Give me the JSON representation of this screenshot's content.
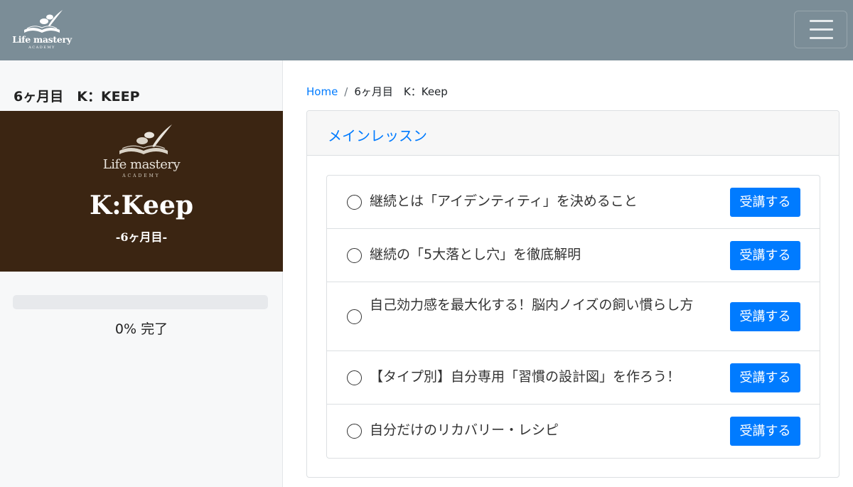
{
  "brand": {
    "logo_text": "Life mastery",
    "logo_subtext": "ACADEMY"
  },
  "navbar": {
    "menu_icon": "hamburger-icon",
    "background": "#7b8d97"
  },
  "sidebar": {
    "title": "6ヶ月目　K：KEEP",
    "banner": {
      "logo_text": "Life mastery",
      "logo_subtext": "ACADEMY",
      "title": "K:Keep",
      "subtitle": "-6ヶ月目-",
      "background": "#3b2512"
    },
    "progress": {
      "percent": 0,
      "label": "0% 完了"
    }
  },
  "breadcrumb": {
    "home": "Home",
    "separator": "/",
    "current": "6ヶ月目　K：Keep"
  },
  "card": {
    "header": "メインレッスン"
  },
  "lessons": [
    {
      "title": "継続とは「アイデンティティ」を決めること",
      "button": "受講する",
      "completed": false
    },
    {
      "title": "継続の「5大落とし穴」を徹底解明",
      "button": "受講する",
      "completed": false
    },
    {
      "title": "自己効力感を最大化する！脳内ノイズの飼い慣らし方",
      "button": "受講する",
      "completed": false
    },
    {
      "title": "【タイプ別】自分専用「習慣の設計図」を作ろう！",
      "button": "受講する",
      "completed": false
    },
    {
      "title": "自分だけのリカバリー・レシピ",
      "button": "受講する",
      "completed": false
    }
  ],
  "colors": {
    "accent": "#007bff",
    "sidebar_background": "#f7f8f9"
  }
}
